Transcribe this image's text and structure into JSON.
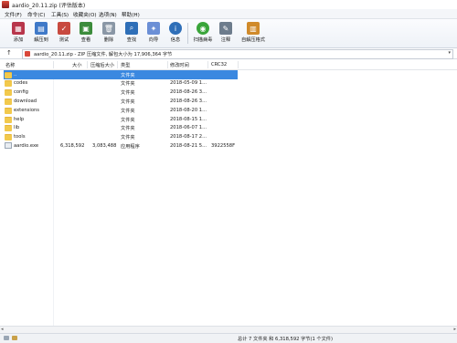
{
  "window": {
    "title": "aardio_20.11.zip (评估版本)"
  },
  "menu": [
    "文件(F)",
    "命令(C)",
    "工具(S)",
    "收藏夹(O)",
    "选项(N)",
    "帮助(H)"
  ],
  "toolbar": [
    {
      "label": "添加",
      "icon": "add-archive-icon",
      "color": "#b8364b"
    },
    {
      "label": "解压到",
      "icon": "extract-to-icon",
      "color": "#3f79c8"
    },
    {
      "label": "测试",
      "icon": "test-icon",
      "color": "#c84a3f"
    },
    {
      "label": "查看",
      "icon": "view-icon",
      "color": "#3c8c3c"
    },
    {
      "label": "删除",
      "icon": "delete-icon",
      "color": "#8a97a6"
    },
    {
      "label": "查找",
      "icon": "find-icon",
      "color": "#2f6fb8"
    },
    {
      "label": "向导",
      "icon": "wizard-icon",
      "color": "#6b8fd6"
    },
    {
      "label": "信息",
      "icon": "info-icon",
      "color": "#2f6fb8"
    },
    {
      "label": "扫描病毒",
      "icon": "scan-virus-icon",
      "color": "#3aa53a"
    },
    {
      "label": "注释",
      "icon": "comment-icon",
      "color": "#6d7c8c"
    },
    {
      "label": "自解压格式",
      "icon": "sfx-icon",
      "color": "#d08a2a"
    }
  ],
  "address": {
    "text": "aardio_20.11.zip - ZIP 压缩文件, 解包大小为 17,906,364 字节"
  },
  "columns": [
    "名称",
    "大小",
    "压缩后大小",
    "类型",
    "修改时间",
    "CRC32"
  ],
  "files": [
    {
      "name": "..",
      "size": "",
      "packed": "",
      "type": "文件夹",
      "modified": "",
      "crc": "",
      "kind": "folder",
      "selected": true
    },
    {
      "name": "codes",
      "size": "",
      "packed": "",
      "type": "文件夹",
      "modified": "2018-05-09 1...",
      "crc": "",
      "kind": "folder"
    },
    {
      "name": "config",
      "size": "",
      "packed": "",
      "type": "文件夹",
      "modified": "2018-08-26 3...",
      "crc": "",
      "kind": "folder"
    },
    {
      "name": "download",
      "size": "",
      "packed": "",
      "type": "文件夹",
      "modified": "2018-08-26 3...",
      "crc": "",
      "kind": "folder"
    },
    {
      "name": "extensions",
      "size": "",
      "packed": "",
      "type": "文件夹",
      "modified": "2018-08-20 1...",
      "crc": "",
      "kind": "folder"
    },
    {
      "name": "help",
      "size": "",
      "packed": "",
      "type": "文件夹",
      "modified": "2018-08-15 1...",
      "crc": "",
      "kind": "folder"
    },
    {
      "name": "lib",
      "size": "",
      "packed": "",
      "type": "文件夹",
      "modified": "2018-06-07 1...",
      "crc": "",
      "kind": "folder"
    },
    {
      "name": "tools",
      "size": "",
      "packed": "",
      "type": "文件夹",
      "modified": "2018-08-17 2...",
      "crc": "",
      "kind": "folder"
    },
    {
      "name": "aardio.exe",
      "size": "6,318,592",
      "packed": "3,083,488",
      "type": "应用程序",
      "modified": "2018-08-21 5...",
      "crc": "3922558F",
      "kind": "exe"
    }
  ],
  "status": {
    "text": "总计 7 文件夹 和 6,318,592 字节(1 个文件)"
  },
  "colors": {
    "selection": "#3a88e0",
    "folder": "#f2c94c"
  }
}
